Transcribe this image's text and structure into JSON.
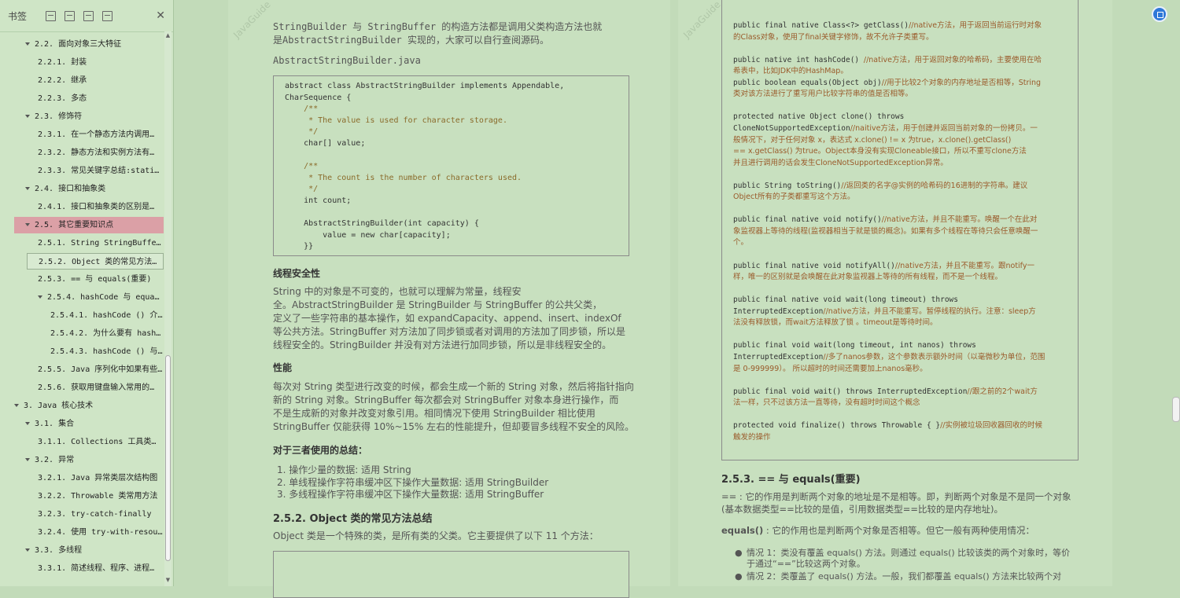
{
  "sidebar": {
    "title": "书签",
    "toc": [
      {
        "label": "2.2. 面向对象三大特征",
        "indent": 1,
        "tri": true
      },
      {
        "label": "2.2.1. 封装",
        "indent": 2
      },
      {
        "label": "2.2.2. 继承",
        "indent": 2
      },
      {
        "label": "2.2.3. 多态",
        "indent": 2
      },
      {
        "label": "2.3. 修饰符",
        "indent": 1,
        "tri": true
      },
      {
        "label": "2.3.1. 在一个静态方法内调用…",
        "indent": 2
      },
      {
        "label": "2.3.2. 静态方法和实例方法有…",
        "indent": 2
      },
      {
        "label": "2.3.3. 常见关键字总结:static…",
        "indent": 2
      },
      {
        "label": "2.4. 接口和抽象类",
        "indent": 1,
        "tri": true
      },
      {
        "label": "2.4.1. 接口和抽象类的区别是…",
        "indent": 2
      },
      {
        "label": "2.5. 其它重要知识点",
        "indent": 1,
        "tri": true,
        "selected": true
      },
      {
        "label": "2.5.1. String StringBuffer …",
        "indent": 2
      },
      {
        "label": "2.5.2. Object 类的常见方法总结",
        "indent": 2,
        "hover": true
      },
      {
        "label": "2.5.3. == 与 equals(重要)",
        "indent": 2
      },
      {
        "label": "2.5.4. hashCode 与 equals (…",
        "indent": 2,
        "tri": true
      },
      {
        "label": "2.5.4.1. hashCode () 介绍",
        "indent": 3
      },
      {
        "label": "2.5.4.2. 为什么要有 hashC…",
        "indent": 3
      },
      {
        "label": "2.5.4.3. hashCode () 与 e…",
        "indent": 3
      },
      {
        "label": "2.5.5. Java 序列化中如果有些…",
        "indent": 2
      },
      {
        "label": "2.5.6. 获取用键盘输入常用的…",
        "indent": 2
      },
      {
        "label": "3. Java 核心技术",
        "indent": 0,
        "tri": true
      },
      {
        "label": "3.1. 集合",
        "indent": 1,
        "tri": true
      },
      {
        "label": "3.1.1. Collections 工具类和 …",
        "indent": 2
      },
      {
        "label": "3.2. 异常",
        "indent": 1,
        "tri": true
      },
      {
        "label": "3.2.1. Java 异常类层次结构图",
        "indent": 2
      },
      {
        "label": "3.2.2. Throwable 类常用方法",
        "indent": 2
      },
      {
        "label": "3.2.3. try-catch-finally",
        "indent": 2
      },
      {
        "label": "3.2.4. 使用 try-with-resourc…",
        "indent": 2
      },
      {
        "label": "3.3. 多线程",
        "indent": 1,
        "tri": true
      },
      {
        "label": "3.3.1. 简述线程、程序、进程…",
        "indent": 2
      }
    ]
  },
  "left_page": {
    "watermark": "JavaGuide",
    "intro": [
      "StringBuilder 与 StringBuffer 的构造方法都是调用父类构造方法也就",
      "是AbstractStringBuilder 实现的，大家可以自行查阅源码。"
    ],
    "file_label": "AbstractStringBuilder.java",
    "code": [
      "abstract class AbstractStringBuilder implements Appendable,",
      "CharSequence {",
      "    /**",
      "     * The value is used for character storage.",
      "     */",
      "    char[] value;",
      "",
      "    /**",
      "     * The count is the number of characters used.",
      "     */",
      "    int count;",
      "",
      "    AbstractStringBuilder(int capacity) {",
      "        value = new char[capacity];",
      "    }}"
    ],
    "h_thread": "线程安全性",
    "thread_text": [
      "String 中的对象是不可变的，也就可以理解为常量，线程安",
      "全。AbstractStringBuilder 是 StringBuilder 与 StringBuffer 的公共父类，",
      "定义了一些字符串的基本操作，如 expandCapacity、append、insert、indexOf",
      "等公共方法。StringBuffer 对方法加了同步锁或者对调用的方法加了同步锁，所以是",
      "线程安全的。StringBuilder 并没有对方法进行加同步锁，所以是非线程安全的。"
    ],
    "h_perf": "性能",
    "perf_text": [
      "每次对 String 类型进行改变的时候，都会生成一个新的 String 对象，然后将指针指向",
      "新的 String 对象。StringBuffer 每次都会对 StringBuffer 对象本身进行操作，而",
      "不是生成新的对象并改变对象引用。相同情况下使用 StringBuilder 相比使用",
      "StringBuffer 仅能获得 10%~15% 左右的性能提升，但却要冒多线程不安全的风险。"
    ],
    "h_summary": "对于三者使用的总结：",
    "summary_list": [
      "1.  操作少量的数据: 适用 String",
      "2.  单线程操作字符串缓冲区下操作大量数据: 适用 StringBuilder",
      "3.  多线程操作字符串缓冲区下操作大量数据: 适用 StringBuffer"
    ],
    "h_object": "2.5.2. Object 类的常见方法总结",
    "object_text": "Object 类是一个特殊的类，是所有类的父类。它主要提供了以下 11 个方法："
  },
  "right_page": {
    "watermark": "JavaGuide",
    "code": [
      {
        "t": "public final native Class<?> getClass()",
        "c": "//native方法，用于返回当前运行时对象"
      },
      {
        "t": "",
        "c": "的Class对象，使用了final关键字修饰，故不允许子类重写。"
      },
      {
        "t": "",
        "c": ""
      },
      {
        "t": "public native int hashCode() ",
        "c": "//native方法，用于返回对象的哈希码，主要使用在哈"
      },
      {
        "t": "",
        "c": "希表中，比如JDK中的HashMap。"
      },
      {
        "t": "public boolean equals(Object obj)",
        "c": "//用于比较2个对象的内存地址是否相等，String"
      },
      {
        "t": "",
        "c": "类对该方法进行了重写用户比较字符串的值是否相等。"
      },
      {
        "t": "",
        "c": ""
      },
      {
        "t": "protected native Object clone() throws",
        "c": ""
      },
      {
        "t": "CloneNotSupportedException",
        "c": "//naitive方法，用于创建并返回当前对象的一份拷贝。一"
      },
      {
        "t": "",
        "c": "般情况下，对于任何对象 x，表达式 x.clone() != x 为true，x.clone().getClass()"
      },
      {
        "t": "",
        "c": "== x.getClass() 为true。Object本身没有实现Cloneable接口，所以不重写clone方法"
      },
      {
        "t": "",
        "c": "并且进行调用的话会发生CloneNotSupportedException异常。"
      },
      {
        "t": "",
        "c": ""
      },
      {
        "t": "public String toString()",
        "c": "//返回类的名字@实例的哈希码的16进制的字符串。建议"
      },
      {
        "t": "",
        "c": "Object所有的子类都重写这个方法。"
      },
      {
        "t": "",
        "c": ""
      },
      {
        "t": "public final native void notify()",
        "c": "//native方法，并且不能重写。唤醒一个在此对"
      },
      {
        "t": "",
        "c": "象监视器上等待的线程(监视器相当于就是锁的概念)。如果有多个线程在等待只会任意唤醒一"
      },
      {
        "t": "",
        "c": "个。"
      },
      {
        "t": "",
        "c": ""
      },
      {
        "t": "public final native void notifyAll()",
        "c": "//native方法，并且不能重写。跟notify一"
      },
      {
        "t": "",
        "c": "样，唯一的区别就是会唤醒在此对象监视器上等待的所有线程，而不是一个线程。"
      },
      {
        "t": "",
        "c": ""
      },
      {
        "t": "public final native void wait(long timeout) throws",
        "c": ""
      },
      {
        "t": "InterruptedException",
        "c": "//native方法，并且不能重写。暂停线程的执行。注意：sleep方"
      },
      {
        "t": "",
        "c": "法没有释放锁，而wait方法释放了锁 。timeout是等待时间。"
      },
      {
        "t": "",
        "c": ""
      },
      {
        "t": "public final void wait(long timeout, int nanos) throws",
        "c": ""
      },
      {
        "t": "InterruptedException",
        "c": "//多了nanos参数，这个参数表示额外时间（以毫微秒为单位，范围"
      },
      {
        "t": "",
        "c": "是 0-999999）。 所以超时的时间还需要加上nanos毫秒。"
      },
      {
        "t": "",
        "c": ""
      },
      {
        "t": "public final void wait() throws InterruptedException",
        "c": "//跟之前的2个wait方"
      },
      {
        "t": "",
        "c": "法一样，只不过该方法一直等待，没有超时时间这个概念"
      },
      {
        "t": "",
        "c": ""
      },
      {
        "t": "protected void finalize() throws Throwable { }",
        "c": "//实例被垃圾回收器回收的时候"
      },
      {
        "t": "",
        "c": "触发的操作"
      }
    ],
    "h_equals": "2.5.3. == 与 equals(重要)",
    "eq_text1": [
      "== : 它的作用是判断两个对象的地址是不是相等。即，判断两个对象是不是同一个对象",
      "(基本数据类型==比较的是值，引用数据类型==比较的是内存地址)。"
    ],
    "eq_text2_bold": "equals()",
    "eq_text2": " : 它的作用也是判断两个对象是否相等。但它一般有两种使用情况：",
    "bullets": [
      "情况 1：类没有覆盖 equals() 方法。则通过 equals() 比较该类的两个对象时，等价",
      "于通过“==”比较这两个对象。",
      "情况 2：类覆盖了 equals() 方法。一般，我们都覆盖 equals() 方法来比较两个对"
    ]
  }
}
